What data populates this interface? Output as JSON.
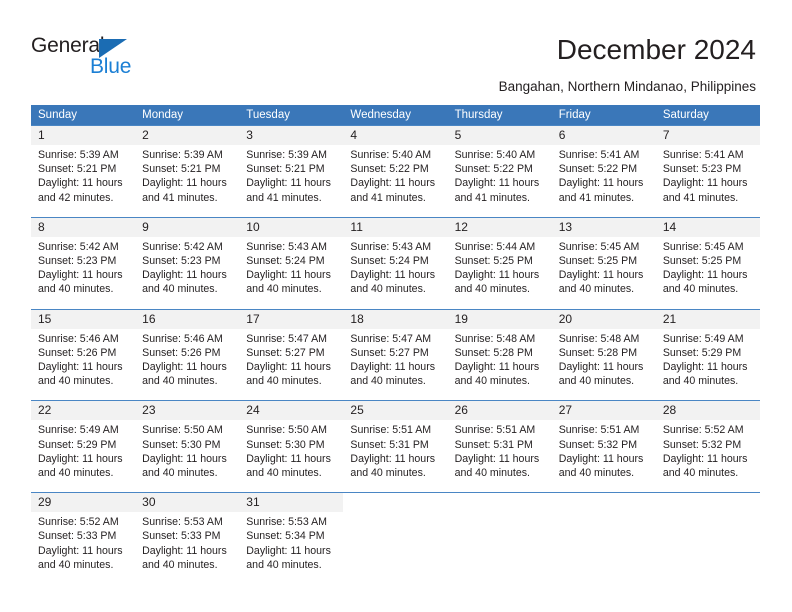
{
  "brand": {
    "name_top": "General",
    "name_bottom": "Blue",
    "triangle_icon": "triangle-icon",
    "accent_blue": "#1b7fd4",
    "header_blue": "#3a77b9"
  },
  "header": {
    "title": "December 2024",
    "subtitle": "Bangahan, Northern Mindanao, Philippines"
  },
  "weekdays": [
    "Sunday",
    "Monday",
    "Tuesday",
    "Wednesday",
    "Thursday",
    "Friday",
    "Saturday"
  ],
  "weeks": [
    [
      {
        "num": "1",
        "sunrise": "Sunrise: 5:39 AM",
        "sunset": "Sunset: 5:21 PM",
        "daylight1": "Daylight: 11 hours",
        "daylight2": "and 42 minutes."
      },
      {
        "num": "2",
        "sunrise": "Sunrise: 5:39 AM",
        "sunset": "Sunset: 5:21 PM",
        "daylight1": "Daylight: 11 hours",
        "daylight2": "and 41 minutes."
      },
      {
        "num": "3",
        "sunrise": "Sunrise: 5:39 AM",
        "sunset": "Sunset: 5:21 PM",
        "daylight1": "Daylight: 11 hours",
        "daylight2": "and 41 minutes."
      },
      {
        "num": "4",
        "sunrise": "Sunrise: 5:40 AM",
        "sunset": "Sunset: 5:22 PM",
        "daylight1": "Daylight: 11 hours",
        "daylight2": "and 41 minutes."
      },
      {
        "num": "5",
        "sunrise": "Sunrise: 5:40 AM",
        "sunset": "Sunset: 5:22 PM",
        "daylight1": "Daylight: 11 hours",
        "daylight2": "and 41 minutes."
      },
      {
        "num": "6",
        "sunrise": "Sunrise: 5:41 AM",
        "sunset": "Sunset: 5:22 PM",
        "daylight1": "Daylight: 11 hours",
        "daylight2": "and 41 minutes."
      },
      {
        "num": "7",
        "sunrise": "Sunrise: 5:41 AM",
        "sunset": "Sunset: 5:23 PM",
        "daylight1": "Daylight: 11 hours",
        "daylight2": "and 41 minutes."
      }
    ],
    [
      {
        "num": "8",
        "sunrise": "Sunrise: 5:42 AM",
        "sunset": "Sunset: 5:23 PM",
        "daylight1": "Daylight: 11 hours",
        "daylight2": "and 40 minutes."
      },
      {
        "num": "9",
        "sunrise": "Sunrise: 5:42 AM",
        "sunset": "Sunset: 5:23 PM",
        "daylight1": "Daylight: 11 hours",
        "daylight2": "and 40 minutes."
      },
      {
        "num": "10",
        "sunrise": "Sunrise: 5:43 AM",
        "sunset": "Sunset: 5:24 PM",
        "daylight1": "Daylight: 11 hours",
        "daylight2": "and 40 minutes."
      },
      {
        "num": "11",
        "sunrise": "Sunrise: 5:43 AM",
        "sunset": "Sunset: 5:24 PM",
        "daylight1": "Daylight: 11 hours",
        "daylight2": "and 40 minutes."
      },
      {
        "num": "12",
        "sunrise": "Sunrise: 5:44 AM",
        "sunset": "Sunset: 5:25 PM",
        "daylight1": "Daylight: 11 hours",
        "daylight2": "and 40 minutes."
      },
      {
        "num": "13",
        "sunrise": "Sunrise: 5:45 AM",
        "sunset": "Sunset: 5:25 PM",
        "daylight1": "Daylight: 11 hours",
        "daylight2": "and 40 minutes."
      },
      {
        "num": "14",
        "sunrise": "Sunrise: 5:45 AM",
        "sunset": "Sunset: 5:25 PM",
        "daylight1": "Daylight: 11 hours",
        "daylight2": "and 40 minutes."
      }
    ],
    [
      {
        "num": "15",
        "sunrise": "Sunrise: 5:46 AM",
        "sunset": "Sunset: 5:26 PM",
        "daylight1": "Daylight: 11 hours",
        "daylight2": "and 40 minutes."
      },
      {
        "num": "16",
        "sunrise": "Sunrise: 5:46 AM",
        "sunset": "Sunset: 5:26 PM",
        "daylight1": "Daylight: 11 hours",
        "daylight2": "and 40 minutes."
      },
      {
        "num": "17",
        "sunrise": "Sunrise: 5:47 AM",
        "sunset": "Sunset: 5:27 PM",
        "daylight1": "Daylight: 11 hours",
        "daylight2": "and 40 minutes."
      },
      {
        "num": "18",
        "sunrise": "Sunrise: 5:47 AM",
        "sunset": "Sunset: 5:27 PM",
        "daylight1": "Daylight: 11 hours",
        "daylight2": "and 40 minutes."
      },
      {
        "num": "19",
        "sunrise": "Sunrise: 5:48 AM",
        "sunset": "Sunset: 5:28 PM",
        "daylight1": "Daylight: 11 hours",
        "daylight2": "and 40 minutes."
      },
      {
        "num": "20",
        "sunrise": "Sunrise: 5:48 AM",
        "sunset": "Sunset: 5:28 PM",
        "daylight1": "Daylight: 11 hours",
        "daylight2": "and 40 minutes."
      },
      {
        "num": "21",
        "sunrise": "Sunrise: 5:49 AM",
        "sunset": "Sunset: 5:29 PM",
        "daylight1": "Daylight: 11 hours",
        "daylight2": "and 40 minutes."
      }
    ],
    [
      {
        "num": "22",
        "sunrise": "Sunrise: 5:49 AM",
        "sunset": "Sunset: 5:29 PM",
        "daylight1": "Daylight: 11 hours",
        "daylight2": "and 40 minutes."
      },
      {
        "num": "23",
        "sunrise": "Sunrise: 5:50 AM",
        "sunset": "Sunset: 5:30 PM",
        "daylight1": "Daylight: 11 hours",
        "daylight2": "and 40 minutes."
      },
      {
        "num": "24",
        "sunrise": "Sunrise: 5:50 AM",
        "sunset": "Sunset: 5:30 PM",
        "daylight1": "Daylight: 11 hours",
        "daylight2": "and 40 minutes."
      },
      {
        "num": "25",
        "sunrise": "Sunrise: 5:51 AM",
        "sunset": "Sunset: 5:31 PM",
        "daylight1": "Daylight: 11 hours",
        "daylight2": "and 40 minutes."
      },
      {
        "num": "26",
        "sunrise": "Sunrise: 5:51 AM",
        "sunset": "Sunset: 5:31 PM",
        "daylight1": "Daylight: 11 hours",
        "daylight2": "and 40 minutes."
      },
      {
        "num": "27",
        "sunrise": "Sunrise: 5:51 AM",
        "sunset": "Sunset: 5:32 PM",
        "daylight1": "Daylight: 11 hours",
        "daylight2": "and 40 minutes."
      },
      {
        "num": "28",
        "sunrise": "Sunrise: 5:52 AM",
        "sunset": "Sunset: 5:32 PM",
        "daylight1": "Daylight: 11 hours",
        "daylight2": "and 40 minutes."
      }
    ],
    [
      {
        "num": "29",
        "sunrise": "Sunrise: 5:52 AM",
        "sunset": "Sunset: 5:33 PM",
        "daylight1": "Daylight: 11 hours",
        "daylight2": "and 40 minutes."
      },
      {
        "num": "30",
        "sunrise": "Sunrise: 5:53 AM",
        "sunset": "Sunset: 5:33 PM",
        "daylight1": "Daylight: 11 hours",
        "daylight2": "and 40 minutes."
      },
      {
        "num": "31",
        "sunrise": "Sunrise: 5:53 AM",
        "sunset": "Sunset: 5:34 PM",
        "daylight1": "Daylight: 11 hours",
        "daylight2": "and 40 minutes."
      },
      {
        "num": "",
        "sunrise": "",
        "sunset": "",
        "daylight1": "",
        "daylight2": ""
      },
      {
        "num": "",
        "sunrise": "",
        "sunset": "",
        "daylight1": "",
        "daylight2": ""
      },
      {
        "num": "",
        "sunrise": "",
        "sunset": "",
        "daylight1": "",
        "daylight2": ""
      },
      {
        "num": "",
        "sunrise": "",
        "sunset": "",
        "daylight1": "",
        "daylight2": ""
      }
    ]
  ]
}
